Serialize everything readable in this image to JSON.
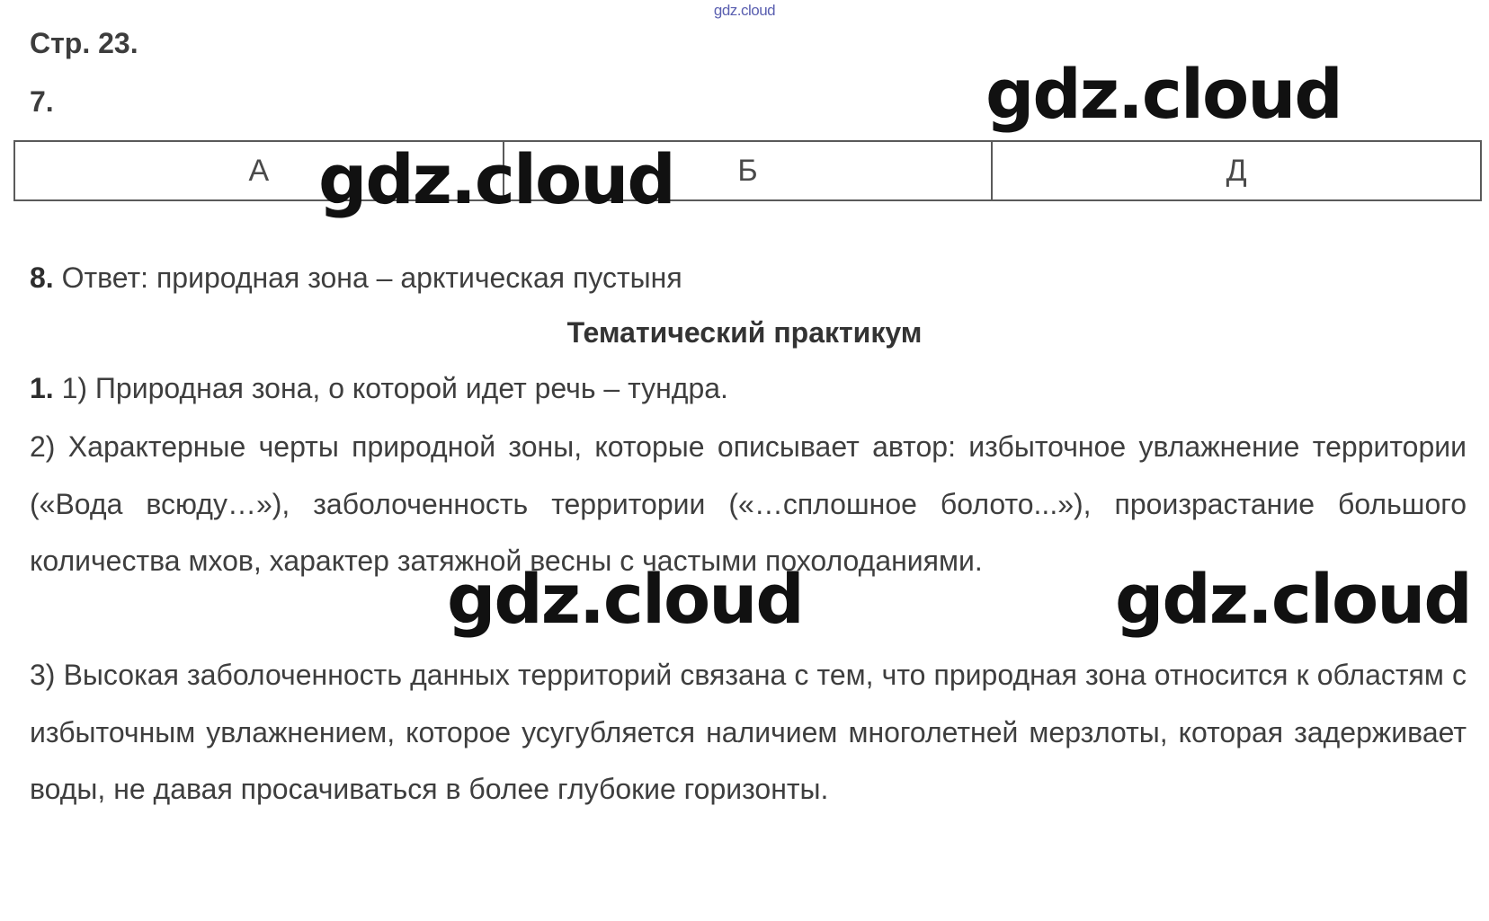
{
  "site_mark": "gdz.cloud",
  "page_label": "Стр. 23.",
  "task7": {
    "number": "7.",
    "table_headers": [
      "А",
      "Б",
      "Д"
    ]
  },
  "task8": {
    "number": "8.",
    "text": "Ответ: природная зона – арктическая пустыня"
  },
  "section_title": "Тематический практикум",
  "task1": {
    "number": "1.",
    "line1": "1) Природная зона, о которой идет речь – тундра.",
    "para2": "2) Характерные черты природной зоны, которые описывает автор: избыточное увлажнение территории («Вода всюду…»), заболоченность территории («…сплошное болото...»), произрастание большого количества мхов, характер затяжной весны с частыми похолоданиями.",
    "para3": "3) Высокая заболоченность данных территорий связана с тем, что природная зона относится к областям с избыточным увлажнением, которое усугубляется наличием многолетней мерзлоты, которая задерживает воды, не давая просачиваться в более глубокие горизонты."
  },
  "watermarks": [
    "gdz.cloud",
    "gdz.cloud",
    "gdz.cloud",
    "gdz.cloud"
  ]
}
